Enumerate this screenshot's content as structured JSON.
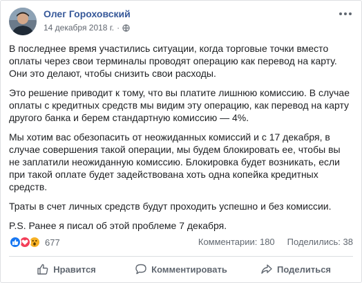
{
  "post": {
    "author": "Олег Гороховский",
    "date": "14 декабря 2018 г.",
    "date_sep": "·",
    "paragraphs": [
      "В последнее время участились ситуации, когда торговые точки вместо оплаты через свои терминалы проводят операцию как перевод на карту. Они это делают, чтобы снизить свои расходы.",
      "Это решение приводит к тому, что вы платите лишнюю комиссию. В случае оплаты с кредитных средств мы видим эту операцию, как перевод на карту другого банка и берем стандартную комиссию — 4%.",
      "Мы хотим вас обезопасить от неожиданных комиссий и с 17 декабря, в случае совершения такой операции, мы будем блокировать ее, чтобы вы не заплатили неожиданную комиссию. Блокировка будет возникать, если при такой оплате будет задействована хоть одна копейка кредитных средств.",
      "Траты в счет личных средств будут проходить успешно и без комиссии.",
      "P.S. Ранее я писал об этой проблеме 7 декабря."
    ],
    "reactions": {
      "count": "677",
      "icons": [
        "like-icon",
        "love-icon",
        "wow-icon"
      ],
      "colors": {
        "like": "#1877f2",
        "love": "#f33e58",
        "wow": "#f7b125"
      }
    },
    "comments": "Комментарии: 180",
    "shares": "Поделились: 38",
    "actions": {
      "like": "Нравится",
      "comment": "Комментировать",
      "share": "Поделиться"
    }
  },
  "colors": {
    "author_link": "#365899",
    "muted": "#606770"
  }
}
